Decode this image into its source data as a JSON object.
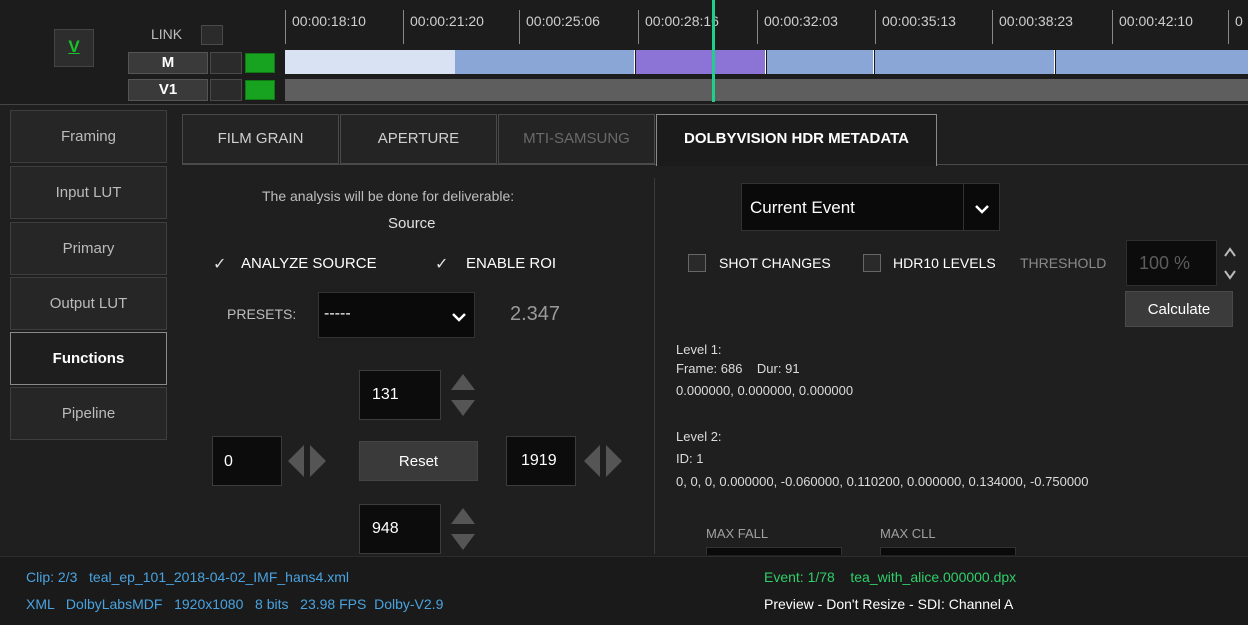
{
  "timeline": {
    "link_label": "LINK",
    "tracks": [
      {
        "label": "M"
      },
      {
        "label": "V1"
      }
    ],
    "logo_letter": "V",
    "timecodes": [
      "00:00:18:10",
      "00:00:21:20",
      "00:00:25:06",
      "00:00:28:16",
      "00:00:32:03",
      "00:00:35:13",
      "00:00:38:23",
      "00:00:42:10",
      "0"
    ]
  },
  "nav": {
    "items": [
      {
        "label": "Framing"
      },
      {
        "label": "Input LUT"
      },
      {
        "label": "Primary"
      },
      {
        "label": "Output LUT"
      },
      {
        "label": "Functions",
        "active": true
      },
      {
        "label": "Pipeline"
      }
    ]
  },
  "tabs": [
    {
      "label": "FILM GRAIN"
    },
    {
      "label": "APERTURE"
    },
    {
      "label": "MTI-SAMSUNG",
      "disabled": true
    },
    {
      "label": "DOLBYVISION HDR METADATA",
      "active": true
    }
  ],
  "left_panel": {
    "info_line": "The analysis will be done for deliverable:",
    "deliverable": "Source",
    "analyze_source_label": "ANALYZE SOURCE",
    "analyze_source_checked": true,
    "enable_roi_label": "ENABLE ROI",
    "enable_roi_checked": true,
    "presets_label": "PRESETS:",
    "presets_value": "-----",
    "aspect_value": "2.347",
    "roi_top": "131",
    "roi_left": "0",
    "roi_right": "1919",
    "roi_bottom": "948",
    "reset_label": "Reset"
  },
  "right_panel": {
    "scope_select": "Current Event",
    "shot_changes_label": "SHOT CHANGES",
    "hdr10_label": "HDR10 LEVELS",
    "threshold_label": "THRESHOLD",
    "threshold_value": "100 %",
    "calculate_label": "Calculate",
    "level1_title": "Level 1:",
    "level1_frame": "Frame: 686    Dur: 91",
    "level1_values": "0.000000, 0.000000, 0.000000",
    "level2_title": "Level 2:",
    "level2_id": "ID: 1",
    "level2_values": "0, 0, 0, 0.000000, -0.060000, 0.110200, 0.000000, 0.134000, -0.750000",
    "max_fall_label": "MAX FALL",
    "max_cll_label": "MAX CLL"
  },
  "status": {
    "clip_line": "Clip: 2/3   teal_ep_101_2018-04-02_IMF_hans4.xml",
    "meta_line": "XML   DolbyLabsMDF   1920x1080   8 bits   23.98 FPS  Dolby-V2.9",
    "event_line": "Event: 1/78    tea_with_alice.000000.dpx",
    "preview_line": "Preview - Don't Resize - SDI: Channel A"
  },
  "colors": {
    "accent_green": "#17a31f",
    "playhead": "#1fd08a",
    "clip_blue": "#8aa6d6",
    "clip_purple": "#8c74d6",
    "status_blue": "#4aa3e0",
    "status_green": "#2fcf6a"
  }
}
